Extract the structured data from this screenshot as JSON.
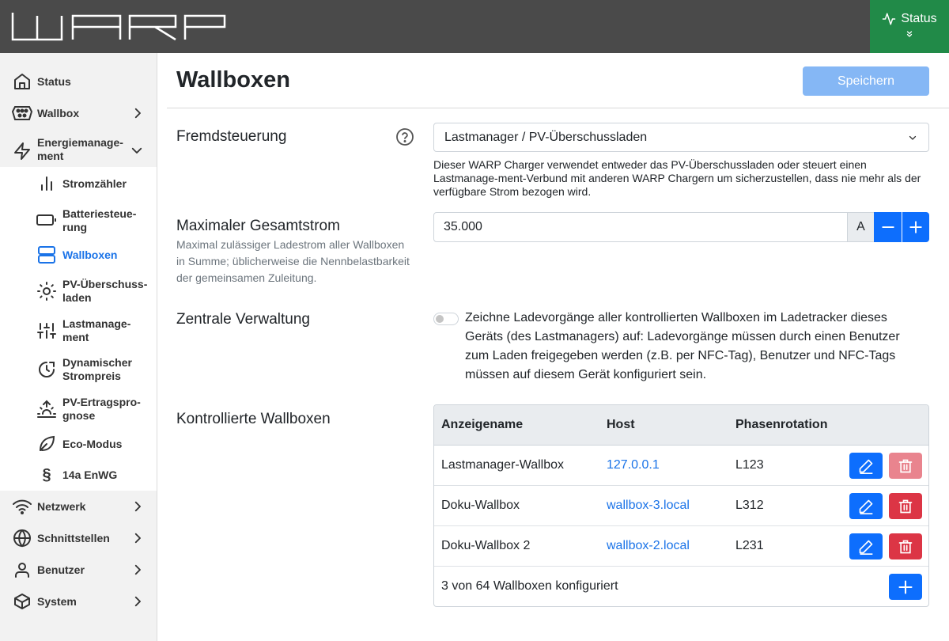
{
  "header": {
    "logo": "WARP",
    "status_label": "Status"
  },
  "sidebar": {
    "items": [
      {
        "label": "Status",
        "icon": "home-icon"
      },
      {
        "label": "Wallbox",
        "icon": "wallbox-icon"
      },
      {
        "label": "Energiemanage-\nment",
        "icon": "energy-bolt-icon"
      },
      {
        "label": "Netzwerk",
        "icon": "wifi-icon"
      },
      {
        "label": "Schnittstellen",
        "icon": "globe-icon"
      },
      {
        "label": "Benutzer",
        "icon": "user-icon"
      },
      {
        "label": "System",
        "icon": "box-icon"
      }
    ],
    "subitems": [
      {
        "label": "Stromzähler",
        "icon": "bar-chart-icon"
      },
      {
        "label": "Batteriesteue-\nrung",
        "icon": "battery-icon"
      },
      {
        "label": "Wallboxen",
        "icon": "server-icon",
        "active": true
      },
      {
        "label": "PV-Überschuss-\nladen",
        "icon": "sun-icon"
      },
      {
        "label": "Lastmanage-\nment",
        "icon": "sliders-icon"
      },
      {
        "label": "Dynamischer\nStrompreis",
        "icon": "clock-dollar-icon"
      },
      {
        "label": "PV-Ertragspro-\ngnose",
        "icon": "sunrise-icon"
      },
      {
        "label": "Eco-Modus",
        "icon": "leaf-icon"
      },
      {
        "label": "14a EnWG",
        "icon": "paragraph-icon"
      }
    ]
  },
  "main": {
    "title": "Wallboxen",
    "save_label": "Speichern",
    "fremdsteuerung": {
      "label": "Fremdsteuerung",
      "value": "Lastmanager / PV-Überschussladen",
      "description": "Dieser WARP Charger verwendet entweder das PV-Überschussladen oder steuert einen Lastmanage-ment-Verbund mit anderen WARP Chargern um sicherzustellen, dass nie mehr als der verfügbare Strom bezogen wird."
    },
    "max_current": {
      "label": "Maximaler Gesamtstrom",
      "description": "Maximal zulässiger Ladestrom aller Wallboxen in Summe; üblicherweise die Nennbelastbarkeit der gemeinsamen Zuleitung.",
      "value": "35.000",
      "unit": "A"
    },
    "central": {
      "label": "Zentrale Verwaltung",
      "enabled": false,
      "text": "Zeichne Ladevorgänge aller kontrollierten Wallboxen im Ladetracker dieses Geräts (des Lastmanagers) auf: Ladevorgänge müssen durch einen Benutzer zum Laden freigegeben werden (z.B. per NFC-Tag), Benutzer und NFC-Tags müssen auf diesem Gerät konfiguriert sein."
    },
    "controlled": {
      "label": "Kontrollierte Wallboxen",
      "columns": [
        "Anzeigename",
        "Host",
        "Phasenrotation"
      ],
      "rows": [
        {
          "name": "Lastmanager-Wallbox",
          "host": "127.0.0.1",
          "rotation": "L123",
          "delete_disabled": true
        },
        {
          "name": "Doku-Wallbox",
          "host": "wallbox-3.local",
          "rotation": "L312",
          "delete_disabled": false
        },
        {
          "name": "Doku-Wallbox 2",
          "host": "wallbox-2.local",
          "rotation": "L231",
          "delete_disabled": false
        }
      ],
      "footer": "3 von 64 Wallboxen konfiguriert"
    }
  },
  "colors": {
    "topbar": "#4a4a4a",
    "status_green": "#218a48",
    "primary": "#0d6efd",
    "danger": "#dc3545",
    "link": "#1a73e8"
  }
}
